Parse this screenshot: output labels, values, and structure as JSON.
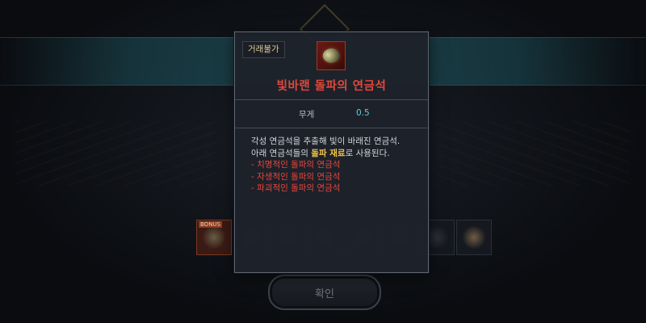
{
  "tooltip": {
    "trade_badge": "거래불가",
    "item_icon": "brilliant-stone-icon",
    "item_name": "빛바랜 돌파의 연금석",
    "stat": {
      "label": "무게",
      "value": "0.5"
    },
    "description": {
      "line1": "각성 연금석을 추출해 빛이 바래진 연금석.",
      "line2_pre": "아래 연금석들의 ",
      "line2_highlight": "돌파 재료",
      "line2_post": "로 사용된다.",
      "list": [
        "- 치명적인 돌파의 연금석",
        "- 자생적인 돌파의 연금석",
        "- 파괴적인 돌파의 연금석"
      ]
    }
  },
  "inventory": {
    "first_slot_badge": "BONUS"
  },
  "confirm_button": {
    "label": "확인"
  },
  "colors": {
    "item_name": "#e0483c",
    "highlight": "#f0c24a",
    "stat_value": "#5fd0d8",
    "list_red": "#ee4438"
  }
}
